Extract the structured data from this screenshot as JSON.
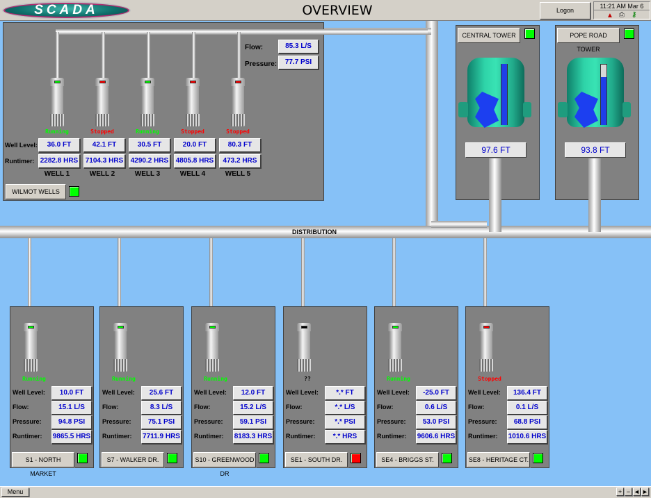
{
  "header": {
    "logo_text": "SCADA",
    "title": "OVERVIEW",
    "logon_label": "Logon",
    "clock": "11:21 AM Mar 6",
    "icons": [
      "bell-icon",
      "printer-icon",
      "key-icon"
    ]
  },
  "colors": {
    "running": "#00ff00",
    "stopped": "#ff0000",
    "unknown": "#000000",
    "background": "#86c1f7",
    "panel": "#818181"
  },
  "wilmot": {
    "flow_label": "Flow:",
    "flow": "85.3 L/S",
    "pressure_label": "Pressure:",
    "pressure": "77.7 PSI",
    "well_level_label": "Well Level:",
    "runtimer_label": "Runtimer:",
    "button": "WILMOT WELLS",
    "wells": [
      {
        "name": "WELL 1",
        "status": "Running",
        "level": "36.0 FT",
        "runtime": "2282.8 HRS",
        "light": "#00ff00"
      },
      {
        "name": "WELL 2",
        "status": "Stopped",
        "level": "42.1 FT",
        "runtime": "7104.3 HRS",
        "light": "#ff0000"
      },
      {
        "name": "WELL 3",
        "status": "Running",
        "level": "30.5 FT",
        "runtime": "4290.2 HRS",
        "light": "#00ff00"
      },
      {
        "name": "WELL 4",
        "status": "Stopped",
        "level": "20.0 FT",
        "runtime": "4805.8 HRS",
        "light": "#ff0000"
      },
      {
        "name": "WELL 5",
        "status": "Stopped",
        "level": "80.3 FT",
        "runtime": "473.2 HRS",
        "light": "#ff0000"
      }
    ]
  },
  "towers": [
    {
      "name": "CENTRAL TOWER",
      "level": "97.6 FT",
      "fill_fraction": 1.0
    },
    {
      "name": "POPE ROAD TOWER",
      "level": "93.8 FT",
      "fill_fraction": 0.78
    }
  ],
  "distribution_label": "DISTRIBUTION",
  "stations": {
    "labels": {
      "level": "Well Level:",
      "flow": "Flow:",
      "pressure": "Pressure:",
      "runtimer": "Runtimer:"
    },
    "items": [
      {
        "name": "S1 - NORTH MARKET",
        "status": "Running",
        "level": "10.0 FT",
        "flow": "15.1 L/S",
        "pressure": "94.8 PSI",
        "runtime": "9865.5 HRS",
        "light": "#00ff00",
        "led": "#00ff00"
      },
      {
        "name": "S7 - WALKER DR.",
        "status": "Running",
        "level": "25.6 FT",
        "flow": "8.3 L/S",
        "pressure": "75.1 PSI",
        "runtime": "7711.9 HRS",
        "light": "#00ff00",
        "led": "#00ff00"
      },
      {
        "name": "S10 - GREENWOOD DR",
        "status": "Running",
        "level": "12.0 FT",
        "flow": "15.2 L/S",
        "pressure": "59.1 PSI",
        "runtime": "8183.3 HRS",
        "light": "#00ff00",
        "led": "#00ff00"
      },
      {
        "name": "SE1 - SOUTH DR.",
        "status": "??",
        "level": "*.* FT",
        "flow": "*.* L/S",
        "pressure": "*.* PSI",
        "runtime": "*.* HRS",
        "light": "#000000",
        "led": "#ff0000"
      },
      {
        "name": "SE4 - BRIGGS ST.",
        "status": "Running",
        "level": "-25.0 FT",
        "flow": "0.6 L/S",
        "pressure": "53.0 PSI",
        "runtime": "9606.6 HRS",
        "light": "#00ff00",
        "led": "#00ff00"
      },
      {
        "name": "SE8 - HERITAGE CT.",
        "status": "Stopped",
        "level": "136.4 FT",
        "flow": "0.1 L/S",
        "pressure": "68.8 PSI",
        "runtime": "1010.6 HRS",
        "light": "#ff0000",
        "led": "#00ff00"
      }
    ]
  },
  "footer": {
    "menu_label": "Menu",
    "controls": [
      "+",
      "−",
      "◄",
      "►"
    ]
  }
}
